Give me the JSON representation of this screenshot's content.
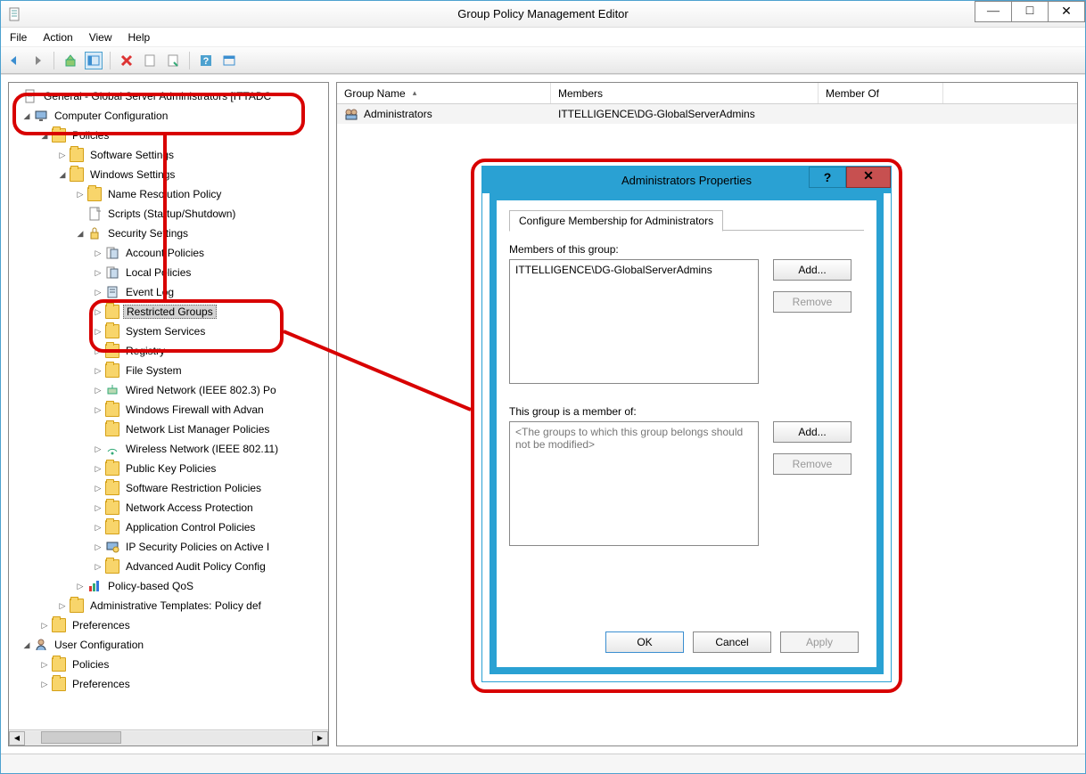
{
  "window": {
    "title": "Group Policy Management Editor",
    "min": "—",
    "max": "□",
    "close": "✕"
  },
  "menu": {
    "file": "File",
    "action": "Action",
    "view": "View",
    "help": "Help"
  },
  "tree": {
    "root": "General - Global Server Administrators [ITTADC",
    "computer_config": "Computer Configuration",
    "policies": "Policies",
    "software_settings": "Software Settings",
    "windows_settings": "Windows Settings",
    "name_res": "Name Resolution Policy",
    "scripts": "Scripts (Startup/Shutdown)",
    "security_settings": "Security Settings",
    "account_policies": "Account Policies",
    "local_policies": "Local Policies",
    "event_log": "Event Log",
    "restricted_groups": "Restricted Groups",
    "system_services": "System Services",
    "registry": "Registry",
    "file_system": "File System",
    "wired": "Wired Network (IEEE 802.3) Po",
    "firewall": "Windows Firewall with Advan",
    "netlist": "Network List Manager Policies",
    "wireless": "Wireless Network (IEEE 802.11)",
    "pki": "Public Key Policies",
    "srp": "Software Restriction Policies",
    "nap": "Network Access Protection",
    "app_ctrl": "Application Control Policies",
    "ipsec": "IP Security Policies on Active I",
    "audit": "Advanced Audit Policy Config",
    "qos": "Policy-based QoS",
    "admintpl": "Administrative Templates: Policy def",
    "prefs_c": "Preferences",
    "user_config": "User Configuration",
    "policies_u": "Policies",
    "prefs_u": "Preferences"
  },
  "list": {
    "col_group": "Group Name",
    "col_members": "Members",
    "col_memberof": "Member Of",
    "row_group": "Administrators",
    "row_members": "ITTELLIGENCE\\DG-GlobalServerAdmins"
  },
  "dialog": {
    "title": "Administrators Properties",
    "tab": "Configure Membership for Administrators",
    "members_label": "Members of this group:",
    "members_value": "ITTELLIGENCE\\DG-GlobalServerAdmins",
    "memberof_label": "This group is a member of:",
    "memberof_placeholder": "<The groups to which this group belongs should not be modified>",
    "add": "Add...",
    "remove": "Remove",
    "ok": "OK",
    "cancel": "Cancel",
    "apply": "Apply",
    "help": "?",
    "close": "✕"
  }
}
